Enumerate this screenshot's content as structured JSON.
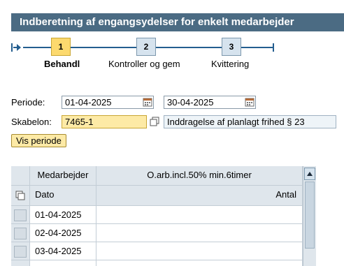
{
  "header": {
    "title": "Indberetning af engangsydelser for enkelt medarbejder"
  },
  "roadmap": {
    "steps": [
      {
        "number": "1",
        "label": "Behandl",
        "active": true
      },
      {
        "number": "2",
        "label": "Kontroller og gem",
        "active": false
      },
      {
        "number": "3",
        "label": "Kvittering",
        "active": false
      }
    ]
  },
  "form": {
    "period_label": "Periode:",
    "period_from": "01-04-2025",
    "period_to": "30-04-2025",
    "template_label": "Skabelon:",
    "template_value": "7465-1",
    "template_description": "Inddragelse af planlagt frihed § 23",
    "show_period_button": "Vis periode"
  },
  "table": {
    "header_row1": {
      "col1": "Medarbejder",
      "col2": "O.arb.incl.50% min.6timer"
    },
    "header_row2": {
      "col1": "Dato",
      "col2": "Antal"
    },
    "rows": [
      {
        "date": "01-04-2025",
        "amount": ""
      },
      {
        "date": "02-04-2025",
        "amount": ""
      },
      {
        "date": "03-04-2025",
        "amount": ""
      }
    ]
  },
  "colors": {
    "title_bar": "#4b6b83",
    "active_step": "#fcd96e",
    "inactive_step": "#d6e3ee",
    "header_cell": "#dfe6ec"
  }
}
